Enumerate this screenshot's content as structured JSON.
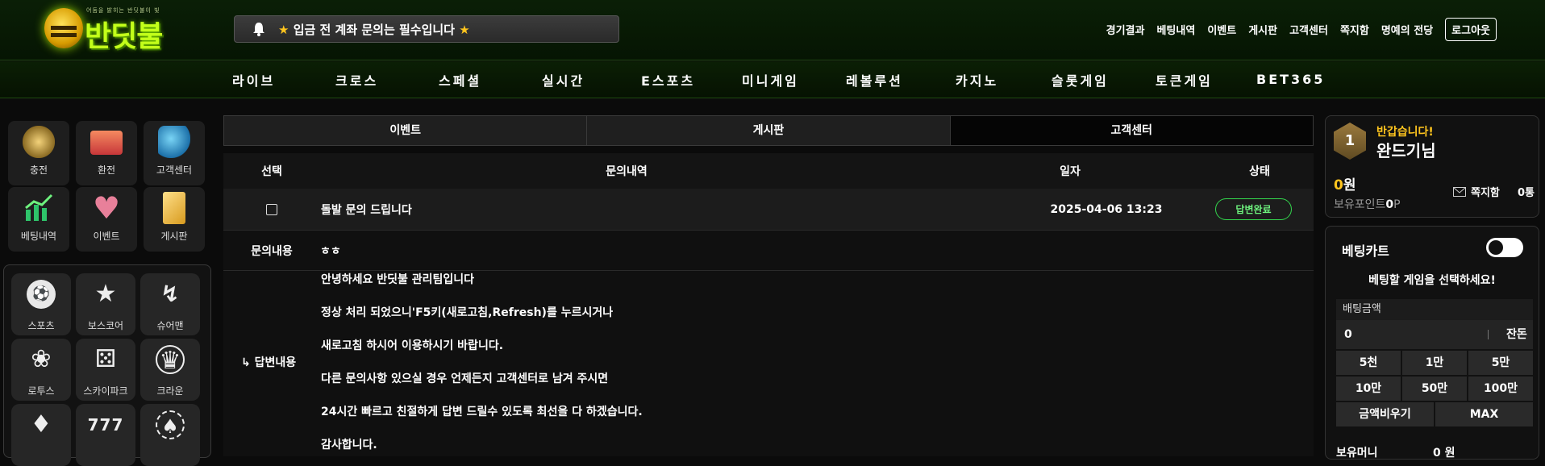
{
  "brand": {
    "name": "반딧불",
    "slogan": "어둠을 밝히는 반딧불이 빛"
  },
  "notice": {
    "text": "입금 전 계좌 문의는 필수입니다",
    "star_color": "#ffc51e"
  },
  "top_nav": [
    "경기결과",
    "베팅내역",
    "이벤트",
    "게시판",
    "고객센터",
    "쪽지함",
    "명예의 전당"
  ],
  "logout_label": "로그아웃",
  "main_nav": [
    "라이브",
    "크로스",
    "스페셜",
    "실시간",
    "E스포츠",
    "미니게임",
    "레볼루션",
    "카지노",
    "슬롯게임",
    "토큰게임",
    "BET365"
  ],
  "quick_menu": [
    {
      "label": "충전",
      "icon": "charge-icon",
      "color": "#d7a84a"
    },
    {
      "label": "환전",
      "icon": "exchange-icon",
      "color": "#e2554a"
    },
    {
      "label": "고객센터",
      "icon": "support-chat-icon",
      "color": "#3aa6d8"
    },
    {
      "label": "베팅내역",
      "icon": "bet-history-chart-icon",
      "color": "#2ec46a"
    },
    {
      "label": "이벤트",
      "icon": "event-heart-icon",
      "color": "#e86b8a"
    },
    {
      "label": "게시판",
      "icon": "board-notes-icon",
      "color": "#e8b53a"
    }
  ],
  "game_menu": [
    {
      "label": "스포츠",
      "icon": "soccer-ball-icon",
      "glyph": "⚽"
    },
    {
      "label": "보스코어",
      "icon": "star-burst-icon",
      "glyph": "★"
    },
    {
      "label": "슈어맨",
      "icon": "arrow-path-icon",
      "glyph": "↯"
    },
    {
      "label": "로투스",
      "icon": "lotus-icon",
      "glyph": "❀"
    },
    {
      "label": "스카이파크",
      "icon": "dice-icon",
      "glyph": "⚄"
    },
    {
      "label": "크라운",
      "icon": "crown-icon",
      "glyph": "♛"
    },
    {
      "label": "",
      "icon": "cards-icon",
      "glyph": "♦"
    },
    {
      "label": "",
      "icon": "slot-777-icon",
      "glyph": "7"
    },
    {
      "label": "",
      "icon": "casino-chip-icon",
      "glyph": "♠"
    }
  ],
  "tabs": [
    {
      "label": "이벤트",
      "active": false
    },
    {
      "label": "게시판",
      "active": false
    },
    {
      "label": "고객센터",
      "active": true
    }
  ],
  "table": {
    "headers": {
      "select": "선택",
      "content": "문의내역",
      "date": "일자",
      "status": "상태"
    },
    "row": {
      "title": "돌발 문의 드립니다",
      "date": "2025-04-06 13:23",
      "status": "답변완료"
    },
    "inquiry": {
      "label": "문의내용",
      "text": "ㅎㅎ"
    },
    "answer": {
      "label": "↳ 답변내용",
      "lines": [
        "안녕하세요 반딧불 관리팀입니다",
        "정상 처리 되었으니'F5키(새로고침,Refresh)를 누르시거나",
        "새로고침 하시어 이용하시기 바랍니다.",
        "다른 문의사항 있으실 경우 언제든지 고객센터로 남겨 주시면",
        "24시간 빠르고 친절하게 답변 드릴수 있도록 최선을 다 하겠습니다.",
        "감사합니다."
      ]
    }
  },
  "user": {
    "level": "1",
    "greeting": "반갑습니다!",
    "name": "완드기님",
    "money": "0",
    "money_unit": "원",
    "point_label": "보유포인트",
    "point": "0",
    "point_unit": "P",
    "msg_label": "쪽지함",
    "msg_count": "0통"
  },
  "cart": {
    "title": "베팅카트",
    "message": "베팅할 게임을 선택하세요!",
    "amount_label": "배팅금액",
    "amount_value": "0",
    "remaining_label": "잔돈",
    "buttons": [
      "5천",
      "1만",
      "5만",
      "10만",
      "50만",
      "100만"
    ],
    "clear_label": "금액비우기",
    "max_label": "MAX",
    "held_label": "보유머니",
    "held_value": "0 원"
  }
}
